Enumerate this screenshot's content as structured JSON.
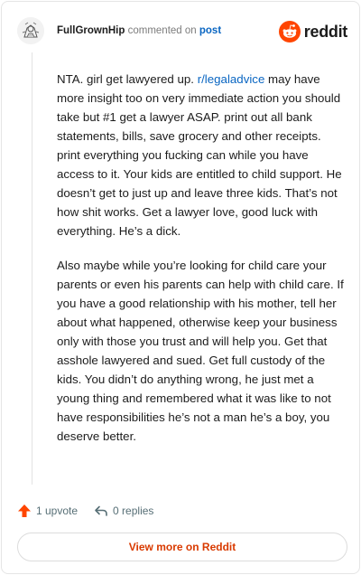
{
  "header": {
    "username": "FullGrownHip",
    "action_text": "commented on",
    "post_link": "post",
    "brand": "reddit"
  },
  "comment": {
    "p1_before": "NTA. girl get lawyered up. ",
    "p1_link": "r/legaladvice",
    "p1_after": " may have more insight too on very immediate action you should take but #1 get a lawyer ASAP. print out all bank statements, bills, save grocery and other receipts. print everything you fucking can while you have access to it. Your kids are entitled to child support. He doesn’t get to just up and leave three kids. That’s not how shit works. Get a lawyer love, good luck with everything. He’s a dick.",
    "p2": "Also maybe while you’re looking for child care your parents or even his parents can help with child care. If you have a good relationship with his mother, tell her about what happened, otherwise keep your business only with those you trust and will help you. Get that asshole lawyered and sued. Get full custody of the kids. You didn’t do anything wrong, he just met a young thing and remembered what it was like to not have responsibilities he’s not a man he’s a boy, you deserve better."
  },
  "footer": {
    "upvote_label": "1 upvote",
    "replies_label": "0 replies",
    "view_more_label": "View more on Reddit"
  },
  "colors": {
    "brand_orange": "#ff4500",
    "link_blue": "#0a66c2",
    "view_more_text": "#d93a00"
  },
  "icons": {
    "avatar": "user-avatar",
    "brand": "reddit-snoo-icon",
    "upvote": "upvote-arrow-icon",
    "reply": "reply-arrow-icon"
  }
}
